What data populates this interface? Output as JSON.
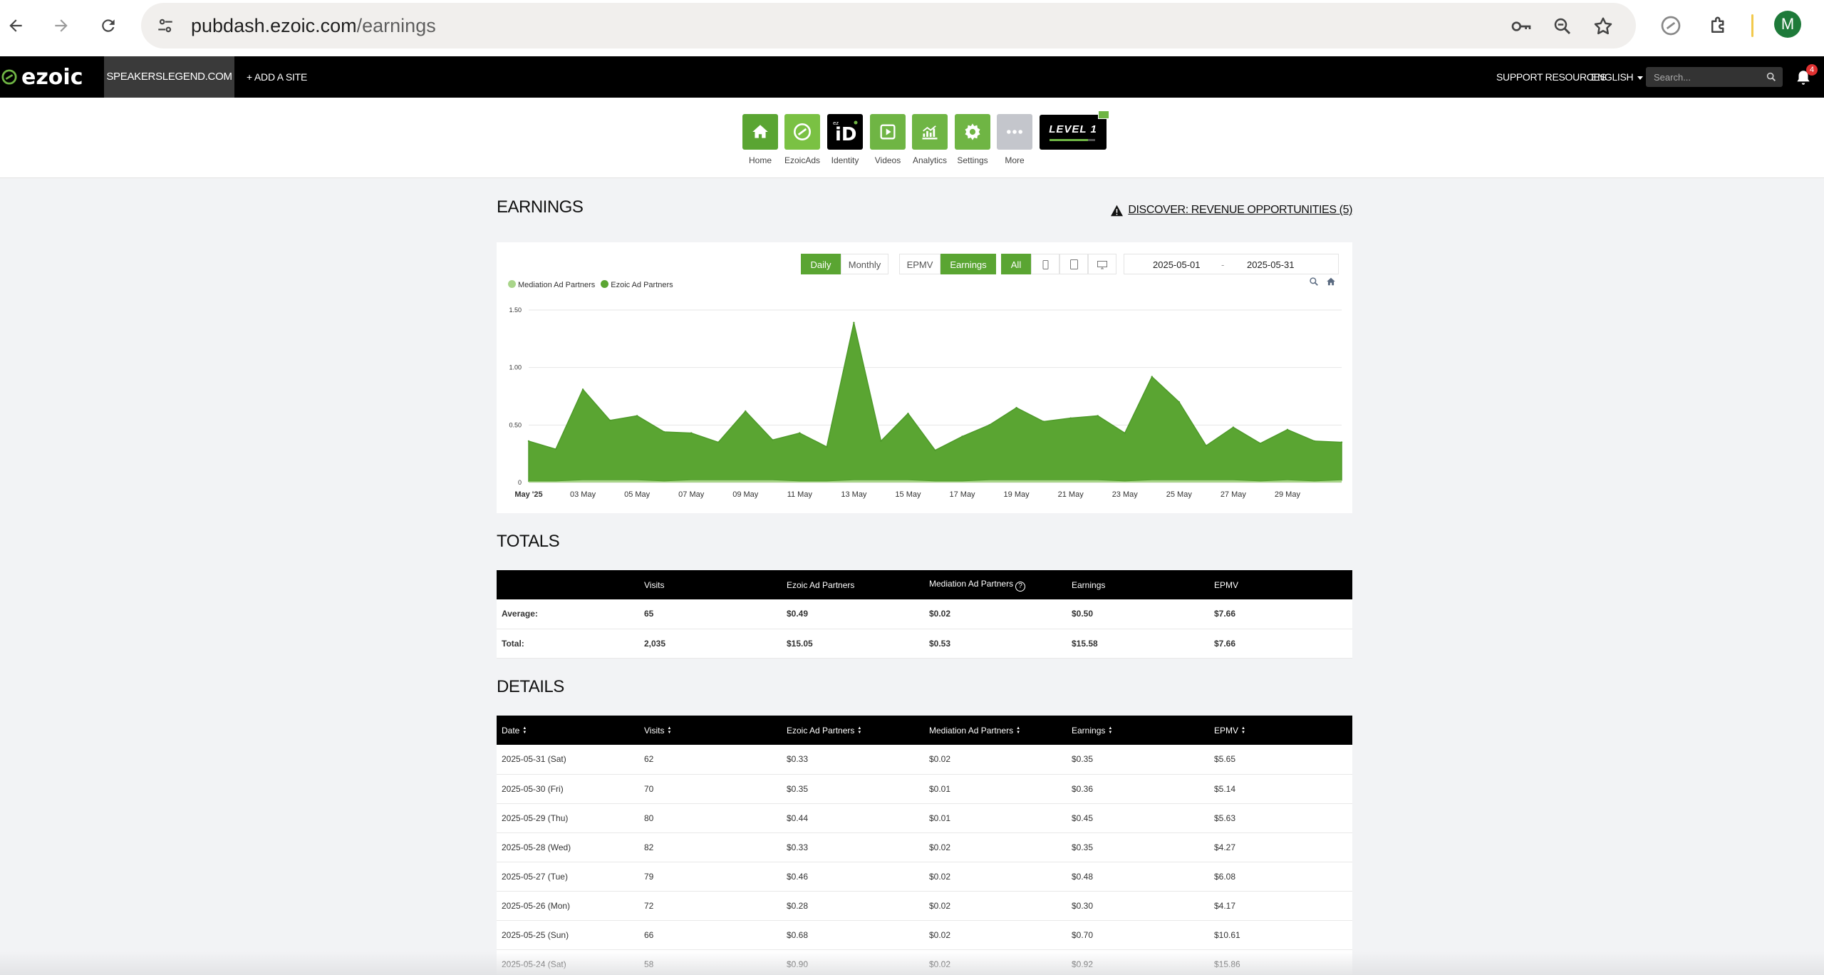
{
  "browser": {
    "url_host": "pubdash.ezoic.com",
    "url_path": "/earnings",
    "avatar_letter": "M"
  },
  "topbar": {
    "logo": "ezoic",
    "site": "SPEAKERSLEGEND.COM",
    "add_site": "+ ADD A SITE",
    "support": "SUPPORT RESOURCES",
    "language": "ENGLISH",
    "search_placeholder": "Search...",
    "notification_count": "4"
  },
  "nav": {
    "items": [
      {
        "label": "Home",
        "icon": "home-icon",
        "color": "#5aa532"
      },
      {
        "label": "EzoicAds",
        "icon": "ezoic-ads-icon",
        "color": "#7ac143"
      },
      {
        "label": "Identity",
        "icon": "identity-icon",
        "color": "#000000"
      },
      {
        "label": "Videos",
        "icon": "video-icon",
        "color": "#6fb544"
      },
      {
        "label": "Analytics",
        "icon": "analytics-icon",
        "color": "#6fb544"
      },
      {
        "label": "Settings",
        "icon": "gear-icon",
        "color": "#6fb544"
      },
      {
        "label": "More",
        "icon": "more-icon",
        "color": "#c4c6cc"
      }
    ],
    "level": "LEVEL 1",
    "level_progress": 0.85
  },
  "earnings": {
    "title": "EARNINGS",
    "discover": "DISCOVER: REVENUE OPPORTUNITIES (5)",
    "controls": {
      "daily": "Daily",
      "monthly": "Monthly",
      "epmv": "EPMV",
      "earnings": "Earnings",
      "all": "All",
      "date_from": "2025-05-01",
      "date_sep": "-",
      "date_to": "2025-05-31"
    }
  },
  "chart_data": {
    "type": "area",
    "title": "",
    "xlabel": "",
    "ylabel": "",
    "ylim": [
      0,
      1.5
    ],
    "y_ticks": [
      "0",
      "0.50",
      "1.00",
      "1.50"
    ],
    "x_ticks": [
      "May '25",
      "03 May",
      "05 May",
      "07 May",
      "09 May",
      "11 May",
      "13 May",
      "15 May",
      "17 May",
      "19 May",
      "21 May",
      "23 May",
      "25 May",
      "27 May",
      "29 May"
    ],
    "legend_position": "top-left",
    "grid": true,
    "x": [
      "2025-05-01",
      "2025-05-02",
      "2025-05-03",
      "2025-05-04",
      "2025-05-05",
      "2025-05-06",
      "2025-05-07",
      "2025-05-08",
      "2025-05-09",
      "2025-05-10",
      "2025-05-11",
      "2025-05-12",
      "2025-05-13",
      "2025-05-14",
      "2025-05-15",
      "2025-05-16",
      "2025-05-17",
      "2025-05-18",
      "2025-05-19",
      "2025-05-20",
      "2025-05-21",
      "2025-05-22",
      "2025-05-23",
      "2025-05-24",
      "2025-05-25",
      "2025-05-26",
      "2025-05-27",
      "2025-05-28",
      "2025-05-29",
      "2025-05-30",
      "2025-05-31"
    ],
    "series": [
      {
        "name": "Mediation Ad Partners",
        "color": "#a9d58a",
        "values": [
          0.01,
          0.01,
          0.02,
          0.02,
          0.02,
          0.01,
          0.02,
          0.02,
          0.02,
          0.02,
          0.01,
          0.01,
          0.02,
          0.02,
          0.02,
          0.01,
          0.01,
          0.02,
          0.02,
          0.02,
          0.02,
          0.02,
          0.01,
          0.02,
          0.02,
          0.02,
          0.02,
          0.01,
          0.02,
          0.01,
          0.02
        ]
      },
      {
        "name": "Ezoic Ad Partners",
        "color": "#5aa532",
        "values": [
          0.35,
          0.28,
          0.79,
          0.52,
          0.56,
          0.43,
          0.41,
          0.33,
          0.6,
          0.35,
          0.42,
          0.3,
          1.37,
          0.34,
          0.58,
          0.27,
          0.39,
          0.48,
          0.63,
          0.51,
          0.54,
          0.56,
          0.42,
          0.9,
          0.68,
          0.3,
          0.46,
          0.33,
          0.44,
          0.35,
          0.33
        ]
      }
    ]
  },
  "totals": {
    "title": "TOTALS",
    "headers": [
      "",
      "Visits",
      "Ezoic Ad Partners",
      "Mediation Ad Partners",
      "Earnings",
      "EPMV"
    ],
    "rows": [
      [
        "Average:",
        "65",
        "$0.49",
        "$0.02",
        "$0.50",
        "$7.66"
      ],
      [
        "Total:",
        "2,035",
        "$15.05",
        "$0.53",
        "$15.58",
        "$7.66"
      ]
    ]
  },
  "details": {
    "title": "DETAILS",
    "headers": [
      "Date",
      "Visits",
      "Ezoic Ad Partners",
      "Mediation Ad Partners",
      "Earnings",
      "EPMV"
    ],
    "rows": [
      [
        "2025-05-31 (Sat)",
        "62",
        "$0.33",
        "$0.02",
        "$0.35",
        "$5.65"
      ],
      [
        "2025-05-30 (Fri)",
        "70",
        "$0.35",
        "$0.01",
        "$0.36",
        "$5.14"
      ],
      [
        "2025-05-29 (Thu)",
        "80",
        "$0.44",
        "$0.01",
        "$0.45",
        "$5.63"
      ],
      [
        "2025-05-28 (Wed)",
        "82",
        "$0.33",
        "$0.02",
        "$0.35",
        "$4.27"
      ],
      [
        "2025-05-27 (Tue)",
        "79",
        "$0.46",
        "$0.02",
        "$0.48",
        "$6.08"
      ],
      [
        "2025-05-26 (Mon)",
        "72",
        "$0.28",
        "$0.02",
        "$0.30",
        "$4.17"
      ],
      [
        "2025-05-25 (Sun)",
        "66",
        "$0.68",
        "$0.02",
        "$0.70",
        "$10.61"
      ],
      [
        "2025-05-24 (Sat)",
        "58",
        "$0.90",
        "$0.02",
        "$0.92",
        "$15.86"
      ]
    ]
  }
}
